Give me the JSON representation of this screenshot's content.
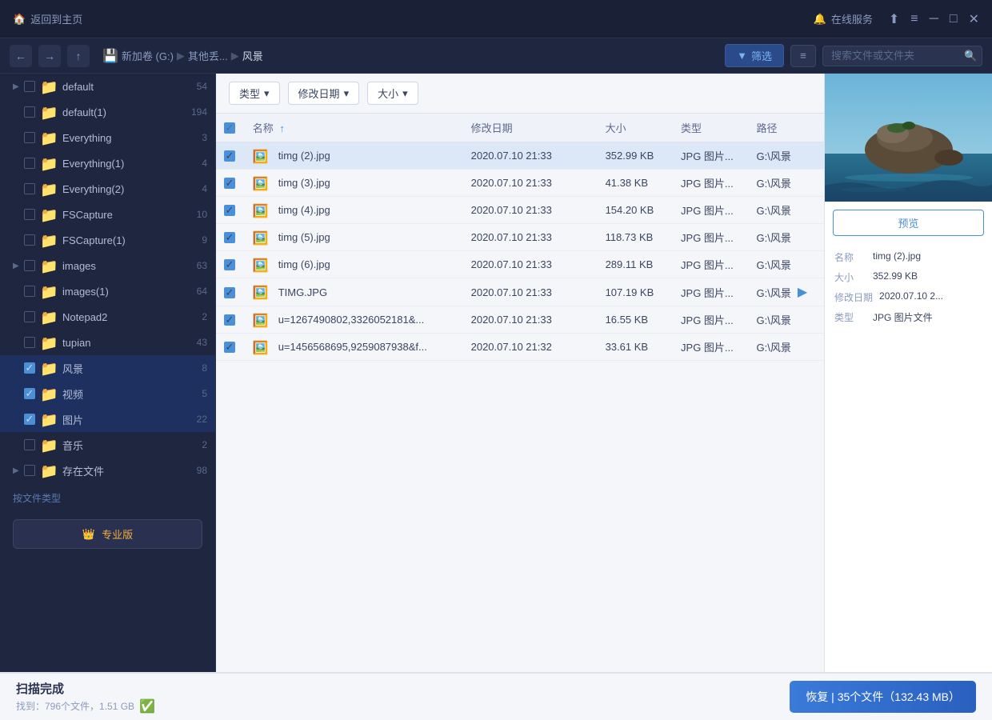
{
  "titlebar": {
    "home_label": "返回到主页",
    "online_label": "在线服务",
    "bell_icon": "🔔",
    "share_icon": "⬆",
    "menu_icon": "≡",
    "min_icon": "─",
    "max_icon": "□",
    "close_icon": "✕"
  },
  "toolbar": {
    "back_icon": "←",
    "forward_icon": "→",
    "up_icon": "↑",
    "drive_label": "新加卷 (G:)",
    "path1": "其他丢...",
    "path2": "风景",
    "filter_label": "筛选",
    "search_placeholder": "搜索文件或文件夹"
  },
  "filter_bar": {
    "type_label": "类型",
    "date_label": "修改日期",
    "size_label": "大小"
  },
  "table": {
    "headers": [
      "",
      "名称",
      "修改日期",
      "大小",
      "类型",
      "路径"
    ],
    "sort_icon": "↑",
    "rows": [
      {
        "checked": true,
        "name": "timg (2).jpg",
        "date": "2020.07.10 21:33",
        "size": "352.99 KB",
        "type": "JPG 图片...",
        "path": "G:\\风景",
        "selected": true
      },
      {
        "checked": true,
        "name": "timg (3).jpg",
        "date": "2020.07.10 21:33",
        "size": "41.38 KB",
        "type": "JPG 图片...",
        "path": "G:\\风景",
        "selected": false
      },
      {
        "checked": true,
        "name": "timg (4).jpg",
        "date": "2020.07.10 21:33",
        "size": "154.20 KB",
        "type": "JPG 图片...",
        "path": "G:\\风景",
        "selected": false
      },
      {
        "checked": true,
        "name": "timg (5).jpg",
        "date": "2020.07.10 21:33",
        "size": "118.73 KB",
        "type": "JPG 图片...",
        "path": "G:\\风景",
        "selected": false
      },
      {
        "checked": true,
        "name": "timg (6).jpg",
        "date": "2020.07.10 21:33",
        "size": "289.11 KB",
        "type": "JPG 图片...",
        "path": "G:\\风景",
        "selected": false
      },
      {
        "checked": true,
        "name": "TIMG.JPG",
        "date": "2020.07.10 21:33",
        "size": "107.19 KB",
        "type": "JPG 图片...",
        "path": "G:\\风景",
        "selected": false
      },
      {
        "checked": true,
        "name": "u=1267490802,3326052181&...",
        "date": "2020.07.10 21:33",
        "size": "16.55 KB",
        "type": "JPG 图片...",
        "path": "G:\\风景",
        "selected": false
      },
      {
        "checked": true,
        "name": "u=1456568695,9259087938&f...",
        "date": "2020.07.10 21:32",
        "size": "33.61 KB",
        "type": "JPG 图片...",
        "path": "G:\\风景",
        "selected": false
      }
    ]
  },
  "preview": {
    "btn_label": "预览",
    "info": {
      "name_label": "名称",
      "name_value": "timg (2).jpg",
      "size_label": "大小",
      "size_value": "352.99 KB",
      "date_label": "修改日期",
      "date_value": "2020.07.10 2...",
      "type_label": "类型",
      "type_value": "JPG 图片文件"
    }
  },
  "sidebar": {
    "items": [
      {
        "id": "default",
        "name": "default",
        "count": "54",
        "expandable": true,
        "checked": false,
        "checked_state": "unchecked"
      },
      {
        "id": "default1",
        "name": "default(1)",
        "count": "194",
        "expandable": false,
        "checked": false,
        "checked_state": "unchecked"
      },
      {
        "id": "everything",
        "name": "Everything",
        "count": "3",
        "expandable": false,
        "checked": false,
        "checked_state": "unchecked"
      },
      {
        "id": "everything1",
        "name": "Everything(1)",
        "count": "4",
        "expandable": false,
        "checked": false,
        "checked_state": "unchecked"
      },
      {
        "id": "everything2",
        "name": "Everything(2)",
        "count": "4",
        "expandable": false,
        "checked": false,
        "checked_state": "unchecked"
      },
      {
        "id": "fscapture",
        "name": "FSCapture",
        "count": "10",
        "expandable": false,
        "checked": false,
        "checked_state": "unchecked"
      },
      {
        "id": "fscapture1",
        "name": "FSCapture(1)",
        "count": "9",
        "expandable": false,
        "checked": false,
        "checked_state": "unchecked"
      },
      {
        "id": "images",
        "name": "images",
        "count": "63",
        "expandable": true,
        "checked": false,
        "checked_state": "unchecked"
      },
      {
        "id": "images1",
        "name": "images(1)",
        "count": "64",
        "expandable": false,
        "checked": false,
        "checked_state": "unchecked"
      },
      {
        "id": "notepad2",
        "name": "Notepad2",
        "count": "2",
        "expandable": false,
        "checked": false,
        "checked_state": "unchecked"
      },
      {
        "id": "tupian",
        "name": "tupian",
        "count": "43",
        "expandable": false,
        "checked": false,
        "checked_state": "unchecked"
      },
      {
        "id": "fengjing",
        "name": "风景",
        "count": "8",
        "expandable": false,
        "checked": true,
        "checked_state": "checked",
        "active": true
      },
      {
        "id": "shipin",
        "name": "视频",
        "count": "5",
        "expandable": false,
        "checked": true,
        "checked_state": "checked"
      },
      {
        "id": "tupian2",
        "name": "图片",
        "count": "22",
        "expandable": false,
        "checked": true,
        "checked_state": "checked"
      },
      {
        "id": "yinyue",
        "name": "音乐",
        "count": "2",
        "expandable": false,
        "checked": false,
        "checked_state": "unchecked"
      },
      {
        "id": "cunzai",
        "name": "存在文件",
        "count": "98",
        "expandable": true,
        "checked": false,
        "checked_state": "unchecked"
      }
    ],
    "footer_text": "按文件类型",
    "pro_label": "专业版"
  },
  "statusbar": {
    "title": "扫描完成",
    "subtitle": "找到：796个文件，1.51 GB",
    "recover_label": "恢复 | 35个文件（132.43 MB）"
  }
}
